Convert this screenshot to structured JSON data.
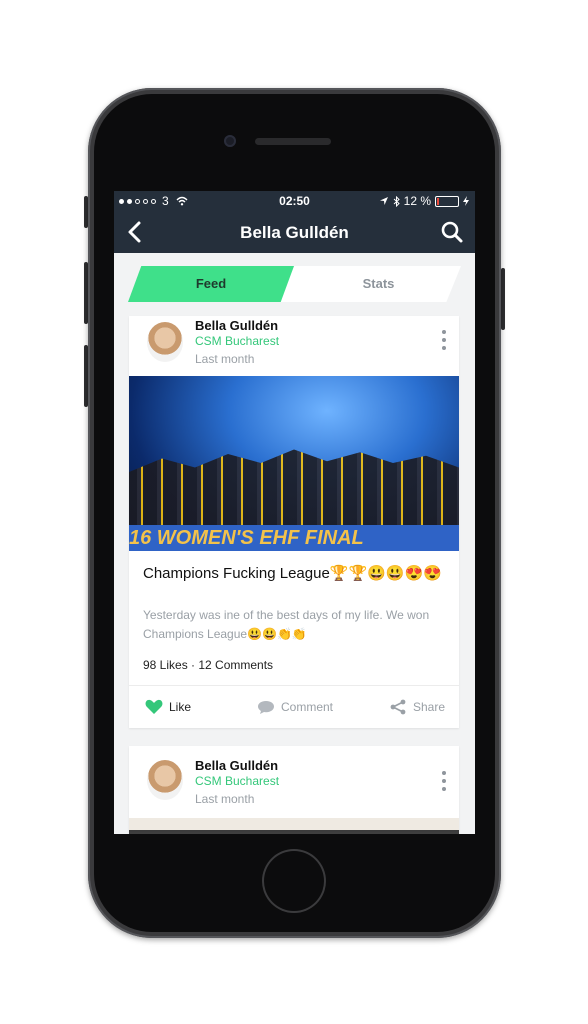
{
  "status_bar": {
    "carrier": "3",
    "time": "02:50",
    "battery_percent": "12 %",
    "battery_level": 0.12
  },
  "navbar": {
    "title": "Bella Gulldén",
    "back_icon": "chevron-left-icon",
    "search_icon": "search-icon"
  },
  "tabs": [
    {
      "label": "Feed",
      "active": true
    },
    {
      "label": "Stats",
      "active": false
    }
  ],
  "colors": {
    "nav_bg": "#252f3b",
    "accent_green": "#3fe08a",
    "team_green": "#34c77a",
    "muted": "#9aa0a6"
  },
  "posts": [
    {
      "author": "Bella Gulldén",
      "team": "CSM Bucharest",
      "time": "Last month",
      "image_banner": "16 WOMEN'S EHF FINAL",
      "title": "Champions Fucking League🏆🏆😃😃😍😍",
      "body": "Yesterday was ine of the best days of my life. We won Champions League😃😃👏👏",
      "stats": "98 Likes · 12 Comments",
      "actions": {
        "like": "Like",
        "comment": "Comment",
        "share": "Share"
      }
    },
    {
      "author": "Bella Gulldén",
      "team": "CSM Bucharest",
      "time": "Last month"
    }
  ]
}
